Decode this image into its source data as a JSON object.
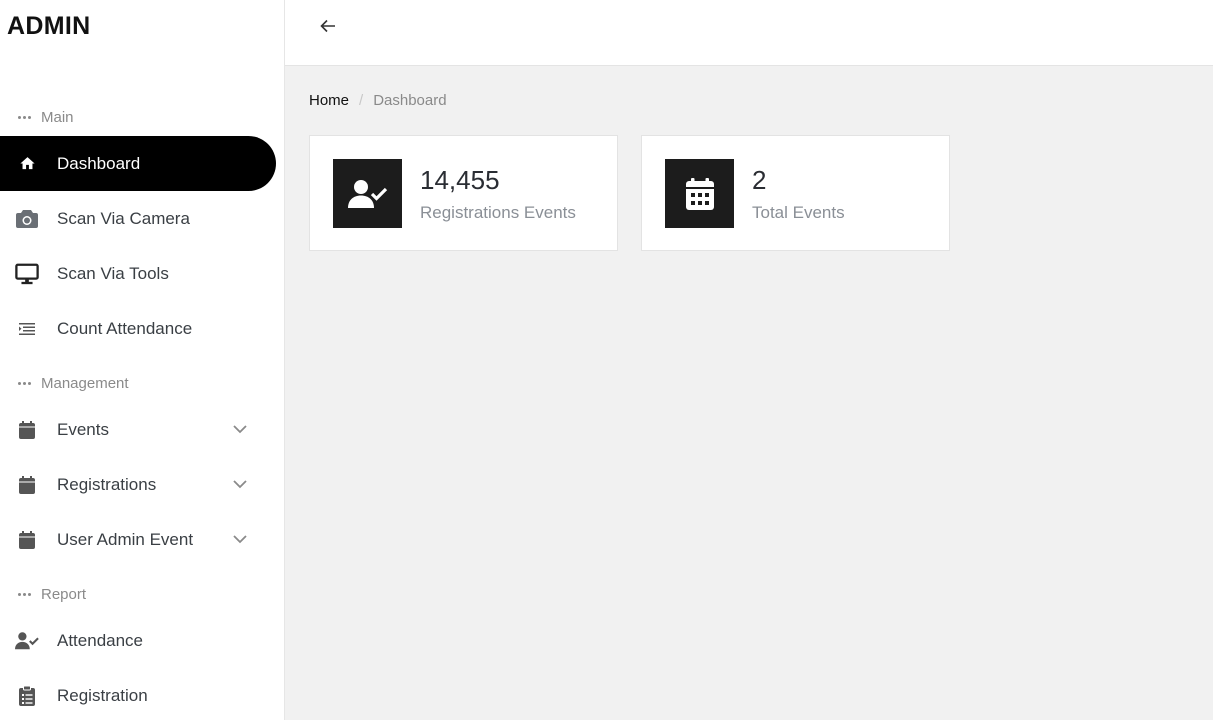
{
  "brand": "ADMIN",
  "sidebar": {
    "sections": [
      {
        "label": "Main"
      },
      {
        "label": "Management"
      },
      {
        "label": "Report"
      }
    ],
    "items": [
      {
        "label": "Dashboard",
        "icon": "home-icon",
        "active": true
      },
      {
        "label": "Scan Via Camera",
        "icon": "camera-icon"
      },
      {
        "label": "Scan Via Tools",
        "icon": "monitor-icon"
      },
      {
        "label": "Count Attendance",
        "icon": "list-indent-icon"
      },
      {
        "label": "Events",
        "icon": "calendar-icon",
        "expandable": true
      },
      {
        "label": "Registrations",
        "icon": "calendar-icon",
        "expandable": true
      },
      {
        "label": "User Admin Event",
        "icon": "calendar-icon",
        "expandable": true
      },
      {
        "label": "Attendance",
        "icon": "user-check-icon"
      },
      {
        "label": "Registration",
        "icon": "clipboard-list-icon"
      }
    ]
  },
  "topbar": {
    "back_icon": "arrow-left-icon"
  },
  "breadcrumb": {
    "home": "Home",
    "separator": "/",
    "current": "Dashboard"
  },
  "cards": [
    {
      "value": "14,455",
      "label": "Registrations Events",
      "icon": "user-check-icon"
    },
    {
      "value": "2",
      "label": "Total Events",
      "icon": "calendar-icon"
    }
  ],
  "colors": {
    "active_bg": "#000000",
    "card_icon_bg": "#1c1c1c",
    "page_bg": "#f1f1f1"
  }
}
